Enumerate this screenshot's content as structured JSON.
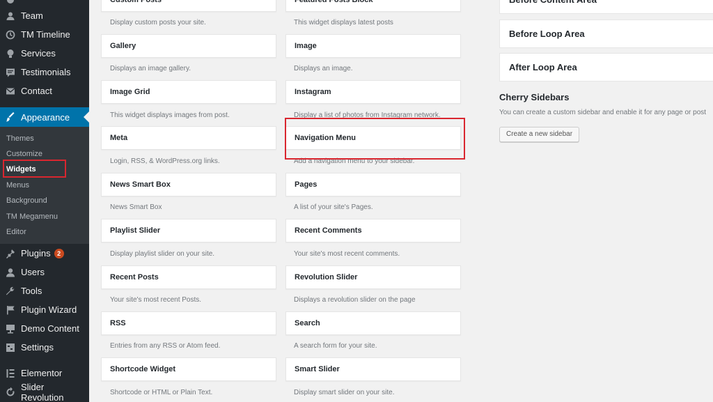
{
  "sidebar": {
    "menu": [
      {
        "label": "Team",
        "icon": "team-icon"
      },
      {
        "label": "TM Timeline",
        "icon": "clock-icon"
      },
      {
        "label": "Services",
        "icon": "lightbulb-icon"
      },
      {
        "label": "Testimonials",
        "icon": "testimonial-icon"
      },
      {
        "label": "Contact",
        "icon": "envelope-icon"
      },
      {
        "label": "Appearance",
        "icon": "paintbrush-icon"
      },
      {
        "label": "Plugins",
        "icon": "plugin-icon",
        "badge": "2"
      },
      {
        "label": "Users",
        "icon": "user-icon"
      },
      {
        "label": "Tools",
        "icon": "wrench-icon"
      },
      {
        "label": "Plugin Wizard",
        "icon": "flag-icon"
      },
      {
        "label": "Demo Content",
        "icon": "demo-icon"
      },
      {
        "label": "Settings",
        "icon": "settings-icon"
      },
      {
        "label": "Elementor",
        "icon": "elementor-icon"
      },
      {
        "label": "Slider Revolution",
        "icon": "refresh-icon"
      }
    ],
    "submenu": [
      "Themes",
      "Customize",
      "Widgets",
      "Menus",
      "Background",
      "TM Megamenu",
      "Editor"
    ]
  },
  "widgets": {
    "left": [
      {
        "title": "Custom Posts",
        "desc": "Display custom posts your site."
      },
      {
        "title": "Gallery",
        "desc": "Displays an image gallery."
      },
      {
        "title": "Image Grid",
        "desc": "This widget displays images from post."
      },
      {
        "title": "Meta",
        "desc": "Login, RSS, & WordPress.org links."
      },
      {
        "title": "News Smart Box",
        "desc": "News Smart Box"
      },
      {
        "title": "Playlist Slider",
        "desc": "Display playlist slider on your site."
      },
      {
        "title": "Recent Posts",
        "desc": "Your site's most recent Posts."
      },
      {
        "title": "RSS",
        "desc": "Entries from any RSS or Atom feed."
      },
      {
        "title": "Shortcode Widget",
        "desc": "Shortcode or HTML or Plain Text."
      }
    ],
    "right": [
      {
        "title": "Featured Posts Block",
        "desc": "This widget displays latest posts"
      },
      {
        "title": "Image",
        "desc": "Displays an image."
      },
      {
        "title": "Instagram",
        "desc": "Display a list of photos from Instagram network."
      },
      {
        "title": "Navigation Menu",
        "desc": "Add a navigation menu to your sidebar."
      },
      {
        "title": "Pages",
        "desc": "A list of your site's Pages."
      },
      {
        "title": "Recent Comments",
        "desc": "Your site's most recent comments."
      },
      {
        "title": "Revolution Slider",
        "desc": "Displays a revolution slider on the page"
      },
      {
        "title": "Search",
        "desc": "A search form for your site."
      },
      {
        "title": "Smart Slider",
        "desc": "Display smart slider on your site."
      }
    ]
  },
  "areas": [
    "Before Content Area",
    "Before Loop Area",
    "After Loop Area"
  ],
  "cherry": {
    "title": "Cherry Sidebars",
    "desc": "You can create a custom sidebar and enable it for any page or post",
    "button": "Create a new sidebar"
  },
  "colors": {
    "accent": "#0073aa",
    "highlight": "#d9262f",
    "sidebar_bg": "#23282d"
  }
}
